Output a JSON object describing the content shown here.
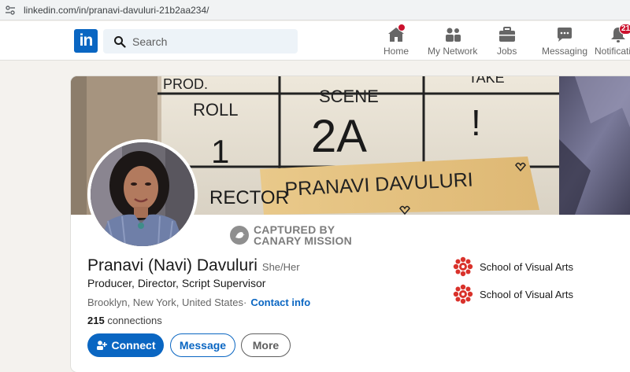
{
  "browser": {
    "url": "linkedin.com/in/pranavi-davuluri-21b2aa234/"
  },
  "nav": {
    "logo": "in",
    "search_placeholder": "Search",
    "items": [
      {
        "label": "Home",
        "icon": "home-icon",
        "badge": ""
      },
      {
        "label": "My Network",
        "icon": "people-icon",
        "badge": ""
      },
      {
        "label": "Jobs",
        "icon": "briefcase-icon",
        "badge": ""
      },
      {
        "label": "Messaging",
        "icon": "chat-icon",
        "badge": ""
      },
      {
        "label": "Notifications",
        "icon": "bell-icon",
        "badge": "21"
      }
    ]
  },
  "cover": {
    "slate_prod": "PROD.",
    "slate_roll": "ROLL",
    "slate_scene": "SCENE",
    "slate_take": "TAKE",
    "slate_roll_val": "1",
    "slate_scene_val": "2A",
    "slate_take_val": "!",
    "slate_director": "RECTOR",
    "slate_name": "PRANAVI DAVULURI"
  },
  "watermark": {
    "line1": "CAPTURED BY",
    "line2": "CANARY MISSION"
  },
  "profile": {
    "name": "Pranavi (Navi) Davuluri",
    "pronouns": "She/Her",
    "headline": "Producer, Director, Script Supervisor",
    "location": "Brooklyn, New York, United States",
    "location_sep": " ·",
    "contact_info": "Contact info",
    "connections_count": "215",
    "connections_label": "connections"
  },
  "actions": {
    "connect": "Connect",
    "message": "Message",
    "more": "More"
  },
  "education": [
    {
      "school": "School of Visual Arts"
    },
    {
      "school": "School of Visual Arts"
    }
  ],
  "colors": {
    "brand": "#0a66c2",
    "badge": "#cb112d",
    "page_bg": "#f4f2ee",
    "sva_red": "#d9322b"
  }
}
